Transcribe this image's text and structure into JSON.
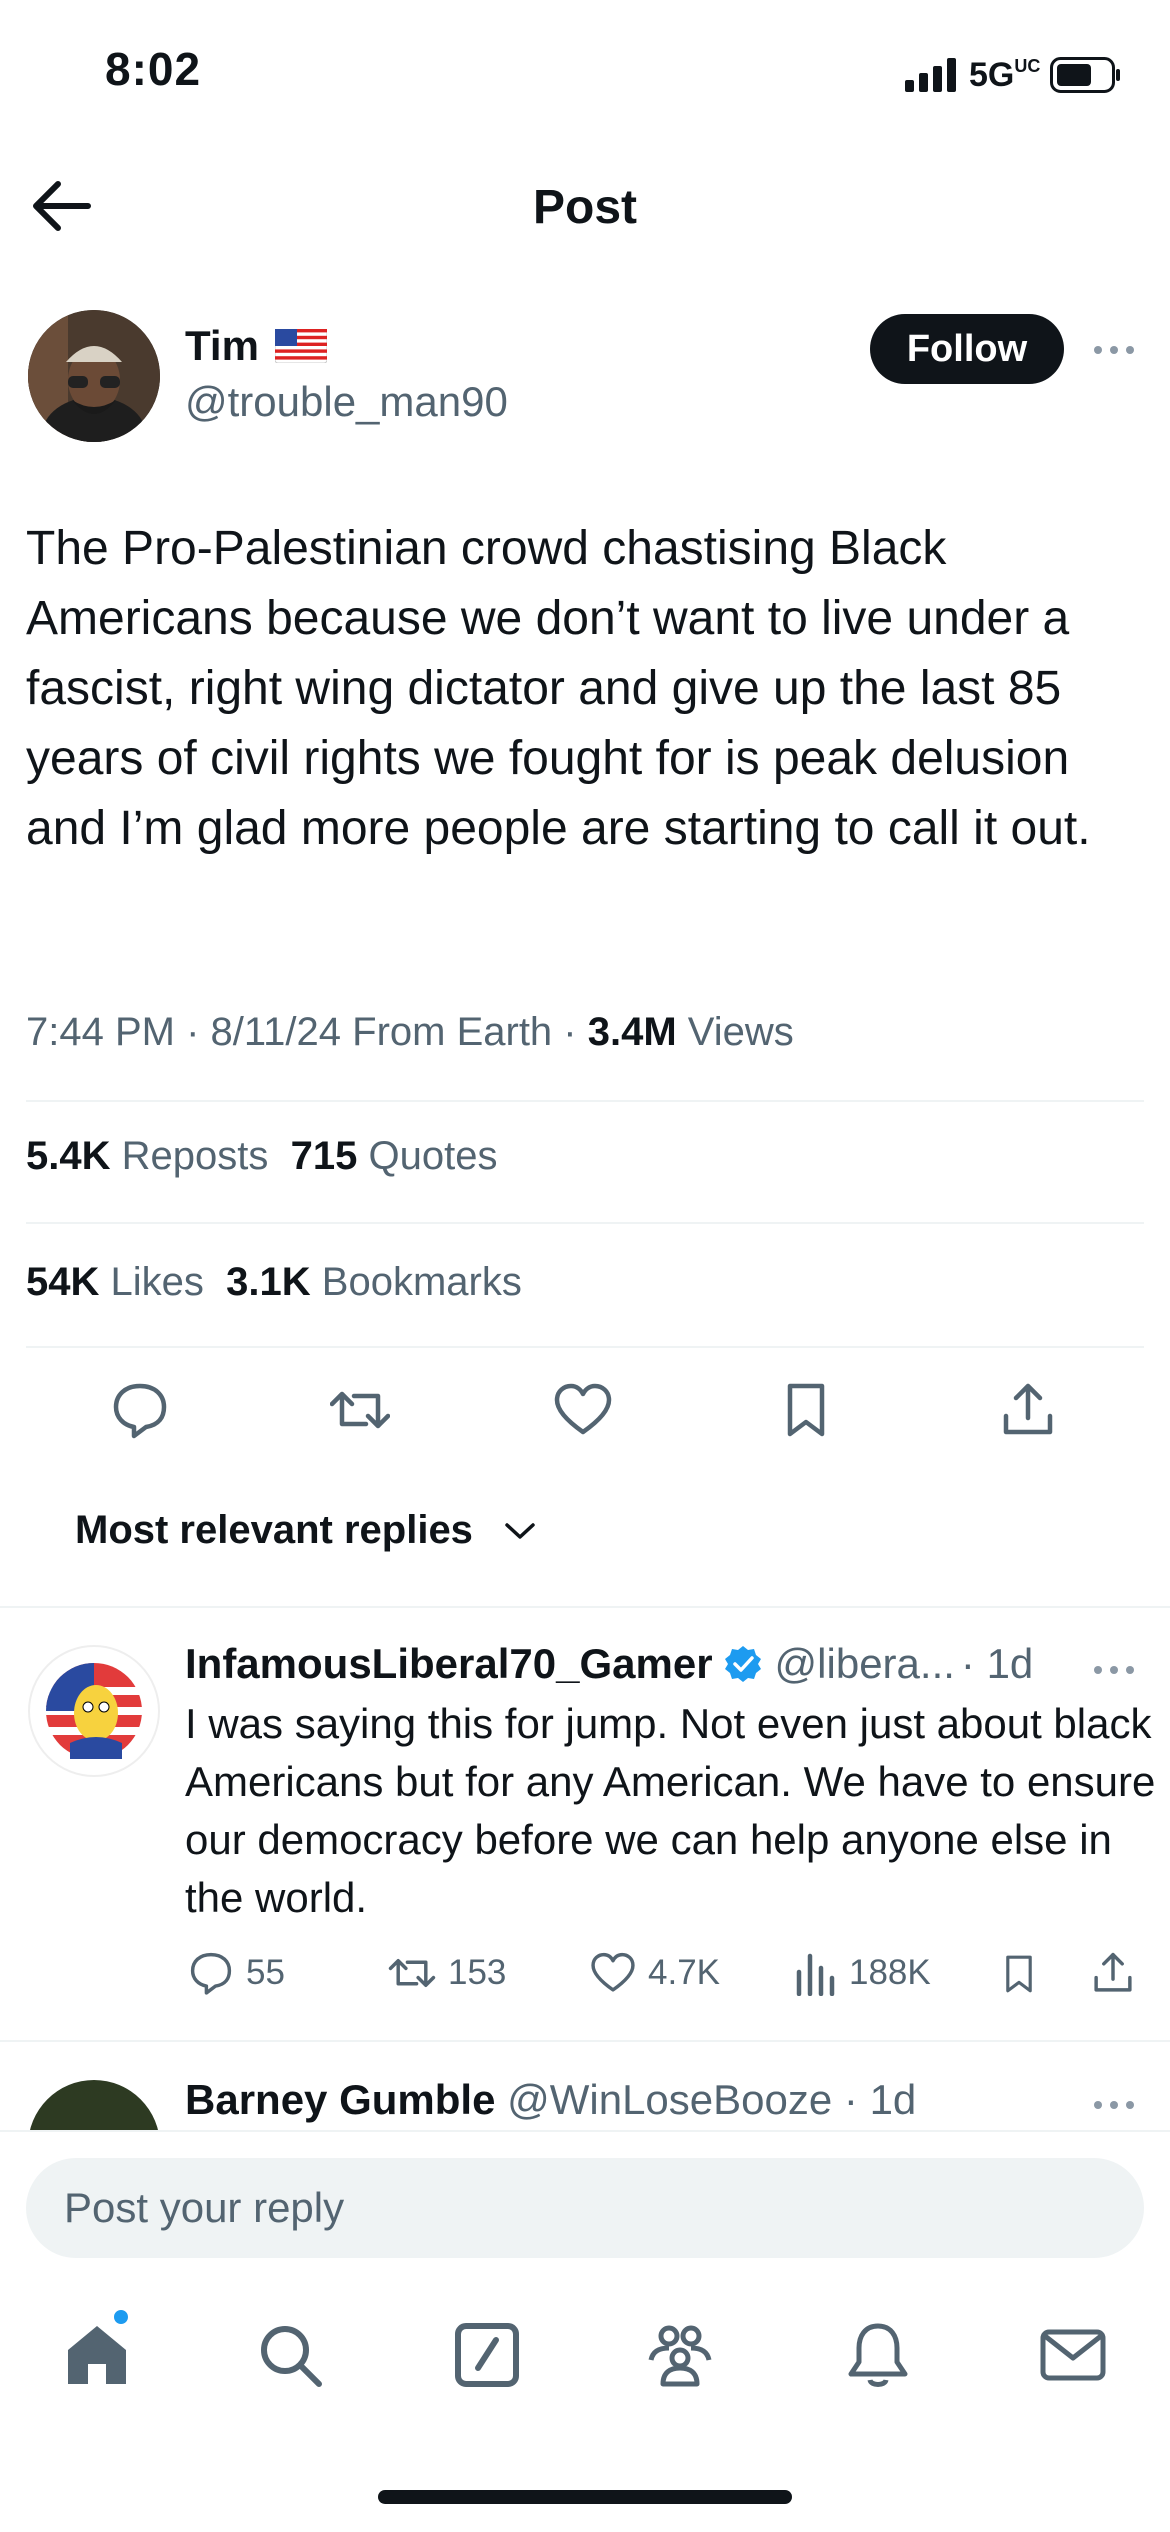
{
  "status_bar": {
    "time": "8:02",
    "network": "5G",
    "network_suffix": "UC"
  },
  "header": {
    "title": "Post"
  },
  "author": {
    "name": "Tim",
    "handle": "@trouble_man90",
    "follow_label": "Follow"
  },
  "post": {
    "text": "The Pro-Palestinian crowd chastising Black Americans because we don’t want to live under a fascist, right wing dictator and give up the last 85 years of civil rights we fought for is peak delusion and I’m glad more people are starting to call it out.",
    "time": "7:44 PM",
    "date": "8/11/24",
    "source": "From Earth",
    "views_count": "3.4M",
    "views_label": "Views"
  },
  "stats": {
    "reposts_count": "5.4K",
    "reposts_label": "Reposts",
    "quotes_count": "715",
    "quotes_label": "Quotes",
    "likes_count": "54K",
    "likes_label": "Likes",
    "bookmarks_count": "3.1K",
    "bookmarks_label": "Bookmarks"
  },
  "replies_sort": {
    "label": "Most relevant replies"
  },
  "reply1": {
    "name": "InfamousLiberal70_Gamer",
    "handle": "@libera...",
    "age": "· 1d",
    "text": "I was saying this for jump. Not even just about black Americans but for any American. We have to ensure our democracy before we can help anyone else in the world.",
    "replies": "55",
    "reposts": "153",
    "likes": "4.7K",
    "views": "188K"
  },
  "reply2": {
    "name": "Barney Gumble",
    "handle": "@WinLoseBooze",
    "age": "· 1d"
  },
  "composer": {
    "placeholder": "Post your reply"
  },
  "colors": {
    "text": "#0f1419",
    "secondary": "#536471",
    "accent": "#1d9bf0",
    "divider": "#eff3f4"
  },
  "icons": [
    "back-arrow-icon",
    "more-icon",
    "reply-icon",
    "repost-icon",
    "like-icon",
    "bookmark-icon",
    "share-icon",
    "verified-icon",
    "home-icon",
    "search-icon",
    "compose-icon",
    "communities-icon",
    "notifications-icon",
    "messages-icon"
  ]
}
